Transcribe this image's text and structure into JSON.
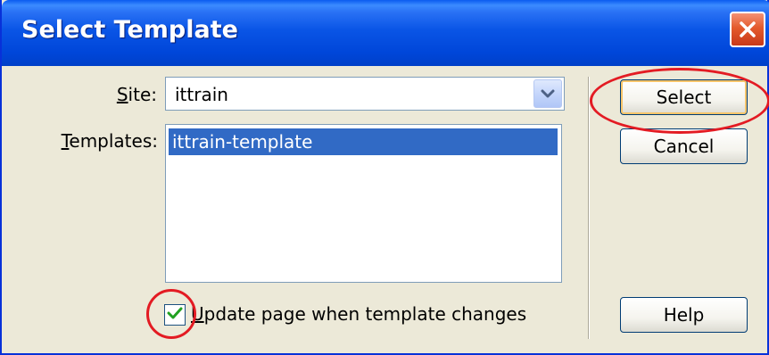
{
  "window": {
    "title": "Select Template"
  },
  "site": {
    "label_accel": "S",
    "label_rest": "ite:",
    "value": "ittrain"
  },
  "templates": {
    "label_accel": "T",
    "label_rest": "emplates:",
    "items": [
      "ittrain-template"
    ],
    "selected_index": 0
  },
  "update_checkbox": {
    "checked": true,
    "label_accel": "U",
    "label_rest": "pdate page when template changes"
  },
  "buttons": {
    "select": "Select",
    "cancel": "Cancel",
    "help": "Help"
  },
  "icons": {
    "close": "close-icon",
    "dropdown": "chevron-down-icon",
    "check": "checkmark-icon"
  },
  "colors": {
    "titlebar": "#0a55e6",
    "selection": "#316ac5",
    "annotation": "#e31b23",
    "dialog_bg": "#ece9d8"
  }
}
